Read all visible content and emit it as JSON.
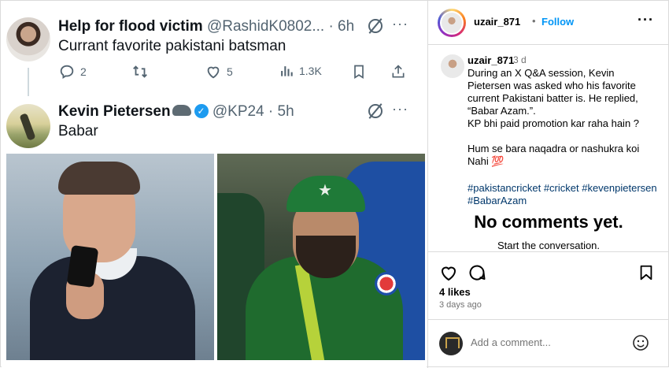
{
  "tweet1": {
    "name": "Help for flood victim",
    "handle_time": "@RashidK0802... · 6h",
    "more": "···",
    "text": "Currant favorite pakistani batsman",
    "replies": "2",
    "likes": "5",
    "views": "1.3K"
  },
  "tweet2": {
    "name": "Kevin Pietersen",
    "verified": "✓",
    "handle_time": "@KP24 · 5h",
    "more": "···",
    "text": "Babar"
  },
  "images": {
    "badge_star": "★"
  },
  "instagram": {
    "header": {
      "username": "uzair_871",
      "dot": "•",
      "follow": "Follow",
      "more": "···"
    },
    "caption": {
      "username": "uzair_871",
      "time": "3 d",
      "text": "During an X Q&A session, Kevin Pietersen was asked who his favorite current Pakistani batter is. He replied, “Babar Azam.”.\nKP bhi paid promotion kar raha hain ?\n\nHum se bara naqadra or nashukra koi Nahi 💯",
      "hashtags": "#pakistancricket #cricket #kevenpietersen #BabarAzam"
    },
    "no_comments": "No comments yet.",
    "start_conversation": "Start the conversation.",
    "likes": "4 likes",
    "ago": "3 days ago",
    "comment_placeholder": "Add a comment..."
  },
  "colors": {
    "x_blue": "#1d9bf0",
    "ig_blue": "#0095f6",
    "muted": "#536471"
  }
}
